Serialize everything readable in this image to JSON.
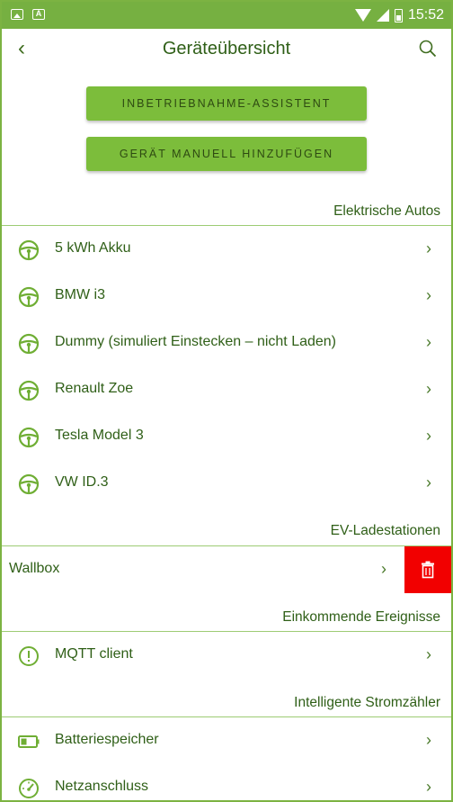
{
  "statusbar": {
    "time": "15:52"
  },
  "appbar": {
    "title": "Geräteübersicht"
  },
  "buttons": {
    "wizard": "INBETRIEBNAHME-ASSISTENT",
    "manual_add": "GERÄT MANUELL HINZUFÜGEN"
  },
  "sections": {
    "cars": "Elektrische Autos",
    "stations": "EV-Ladestationen",
    "events": "Einkommende Ereignisse",
    "meters": "Intelligente Stromzähler"
  },
  "cars": [
    {
      "label": "5 kWh Akku",
      "icon": "steering-wheel-icon"
    },
    {
      "label": "BMW i3",
      "icon": "steering-wheel-icon"
    },
    {
      "label": "Dummy (simuliert Einstecken – nicht Laden)",
      "icon": "steering-wheel-icon"
    },
    {
      "label": "Renault Zoe",
      "icon": "steering-wheel-icon"
    },
    {
      "label": "Tesla Model 3",
      "icon": "steering-wheel-icon"
    },
    {
      "label": "VW ID.3",
      "icon": "steering-wheel-icon"
    }
  ],
  "stations": [
    {
      "label": "Wallbox"
    }
  ],
  "events": [
    {
      "label": "MQTT client",
      "icon": "alert-circle-icon"
    }
  ],
  "meters": [
    {
      "label": "Batteriespeicher",
      "icon": "battery-icon"
    },
    {
      "label": "Netzanschluss",
      "icon": "gauge-icon"
    }
  ],
  "colors": {
    "accent": "#7cbd3b",
    "statusbar": "#76b041",
    "text": "#2f5f17",
    "delete": "#f20000"
  }
}
